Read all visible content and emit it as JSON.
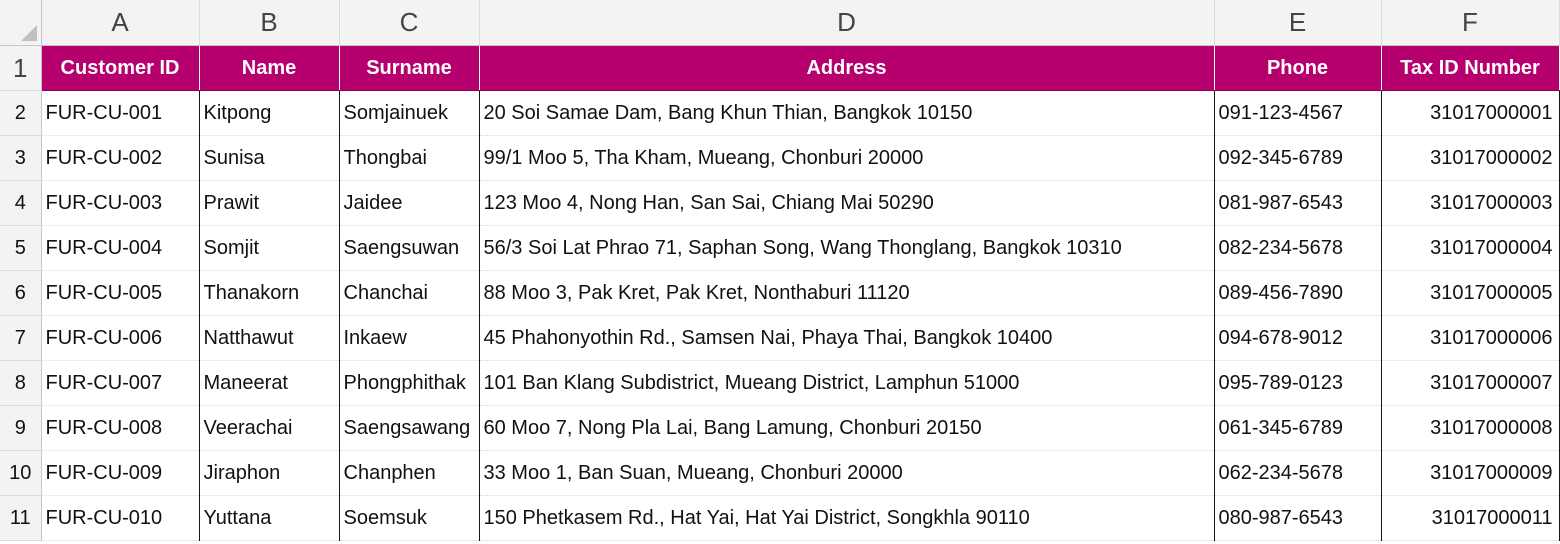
{
  "columns": [
    "A",
    "B",
    "C",
    "D",
    "E",
    "F"
  ],
  "header_color": "#b5006e",
  "headers": [
    "Customer ID",
    "Name",
    "Surname",
    "Address",
    "Phone",
    "Tax ID Number"
  ],
  "header_row_number": "1",
  "rows": [
    {
      "n": "2",
      "cells": [
        "FUR-CU-001",
        "Kitpong",
        "Somjainuek",
        "20 Soi Samae Dam, Bang Khun Thian, Bangkok 10150",
        "091-123-4567",
        "31017000001"
      ]
    },
    {
      "n": "3",
      "cells": [
        "FUR-CU-002",
        "Sunisa",
        "Thongbai",
        "99/1 Moo 5, Tha Kham, Mueang, Chonburi 20000",
        "092-345-6789",
        "31017000002"
      ]
    },
    {
      "n": "4",
      "cells": [
        "FUR-CU-003",
        "Prawit",
        "Jaidee",
        "123 Moo 4, Nong Han, San Sai, Chiang Mai 50290",
        "081-987-6543",
        "31017000003"
      ]
    },
    {
      "n": "5",
      "cells": [
        "FUR-CU-004",
        "Somjit",
        "Saengsuwan",
        "56/3 Soi Lat Phrao 71, Saphan Song, Wang Thonglang, Bangkok 10310",
        "082-234-5678",
        "31017000004"
      ]
    },
    {
      "n": "6",
      "cells": [
        "FUR-CU-005",
        "Thanakorn",
        "Chanchai",
        "88 Moo 3, Pak Kret, Pak Kret, Nonthaburi 11120",
        "089-456-7890",
        "31017000005"
      ]
    },
    {
      "n": "7",
      "cells": [
        "FUR-CU-006",
        "Natthawut",
        "Inkaew",
        "45 Phahonyothin Rd., Samsen Nai, Phaya Thai, Bangkok 10400",
        "094-678-9012",
        "31017000006"
      ]
    },
    {
      "n": "8",
      "cells": [
        "FUR-CU-007",
        "Maneerat",
        "Phongphithak",
        "101 Ban Klang Subdistrict, Mueang District, Lamphun 51000",
        "095-789-0123",
        "31017000007"
      ]
    },
    {
      "n": "9",
      "cells": [
        "FUR-CU-008",
        "Veerachai",
        "Saengsawang",
        "60 Moo 7, Nong Pla Lai, Bang Lamung, Chonburi 20150",
        "061-345-6789",
        "31017000008"
      ]
    },
    {
      "n": "10",
      "cells": [
        "FUR-CU-009",
        "Jiraphon",
        "Chanphen",
        "33 Moo 1, Ban Suan, Mueang, Chonburi 20000",
        "062-234-5678",
        "31017000009"
      ]
    },
    {
      "n": "11",
      "cells": [
        "FUR-CU-010",
        "Yuttana",
        "Soemsuk",
        "150 Phetkasem Rd., Hat Yai, Hat Yai District, Songkhla 90110",
        "080-987-6543",
        "31017000011"
      ]
    }
  ]
}
